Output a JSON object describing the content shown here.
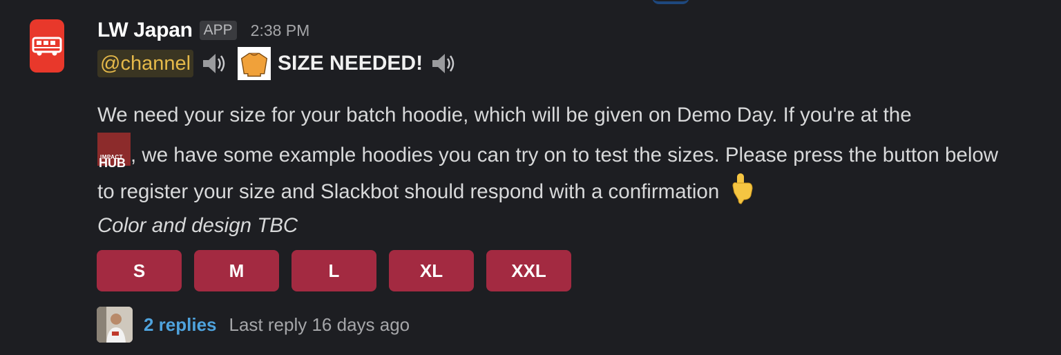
{
  "message": {
    "sender": "LW Japan",
    "app_badge": "APP",
    "timestamp": "2:38 PM",
    "mention": "@channel",
    "headline": "SIZE NEEDED!",
    "body": {
      "part1": "We need your size for your batch hoodie, which will be given on Demo Day. If you're at the",
      "hub_small": "IMPACT",
      "hub_big": "HUB",
      "part2": ", we have some example hoodies you can try on to test the sizes. Please press the button below to register your size and Slackbot should respond with a confirmation",
      "italic": "Color and design TBC"
    },
    "buttons": [
      "S",
      "M",
      "L",
      "XL",
      "XXL"
    ],
    "thread": {
      "replies": "2 replies",
      "last_reply": "Last reply 16 days ago"
    }
  },
  "colors": {
    "background": "#1d1e22",
    "button": "#a32a41",
    "link": "#4fa3dd",
    "mention": "#e5b94a",
    "avatar_bg": "#e8382b"
  },
  "icons": [
    "bus-icon",
    "speaker-icon",
    "sweater-icon",
    "impact-hub-logo",
    "point-down-icon",
    "user-avatar"
  ]
}
